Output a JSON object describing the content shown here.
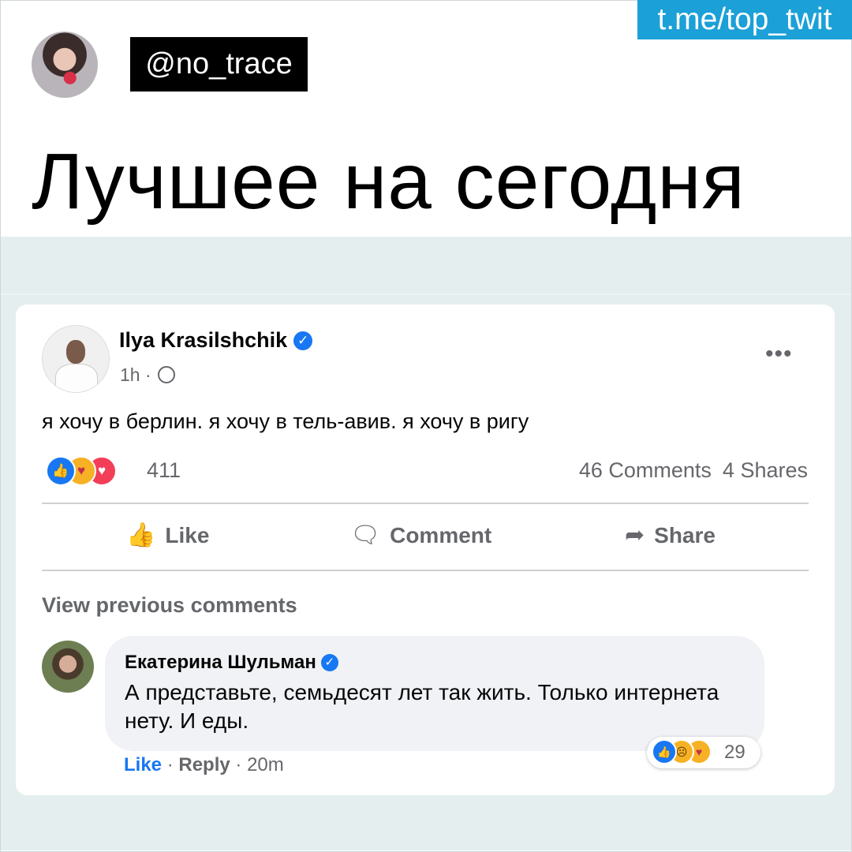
{
  "meme": {
    "channel": "t.me/top_twit",
    "handle": "@no_trace",
    "headline": "Лучшее на сегодня"
  },
  "post": {
    "author": "Ilya Krasilshchik",
    "time": "1h",
    "meta_sep": "·",
    "verified_glyph": "✓",
    "text": "я хочу в берлин. я хочу в тель-авив. я хочу в ригу",
    "more_label": "•••",
    "reactions_count": "411",
    "comments": "46 Comments",
    "shares": "4 Shares",
    "actions": {
      "like": "Like",
      "comment": "Comment",
      "share": "Share"
    },
    "view_previous": "View previous comments"
  },
  "comment": {
    "author": "Екатерина Шульман",
    "text": "А представьте, семьдесят лет так жить. Только интернета нету. И еды.",
    "reactions_count": "29",
    "like": "Like",
    "reply": "Reply",
    "time": "20m",
    "sep": "·"
  },
  "icons": {
    "like": "thumbs-up-icon",
    "comment": "speech-bubble-icon",
    "share": "share-arrow-icon",
    "globe": "globe-icon",
    "more": "more-dots-icon"
  },
  "colors": {
    "brand_blue": "#1877f2",
    "channel_blue": "#1ba0d7",
    "feed_bg": "#e4eeee",
    "secondary_text": "#65676b"
  }
}
